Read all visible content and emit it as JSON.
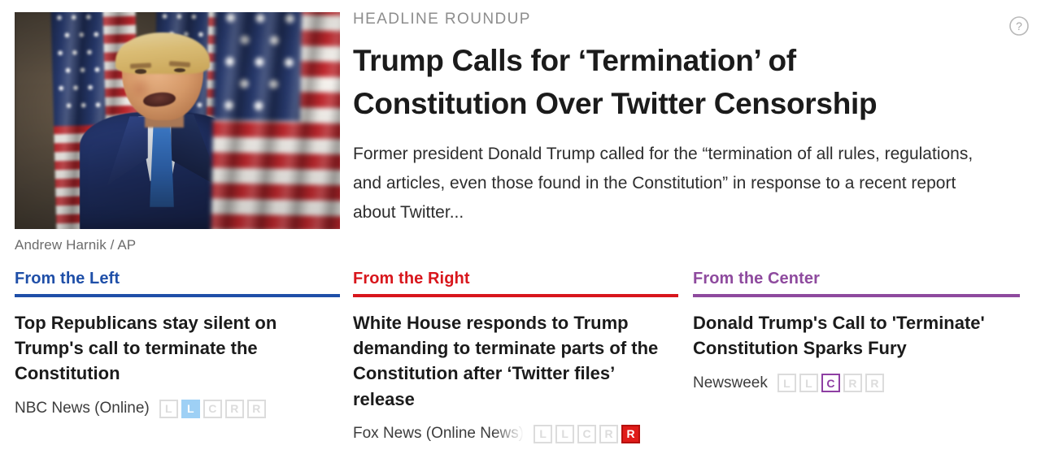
{
  "article": {
    "kicker": "HEADLINE ROUNDUP",
    "headline": "Trump Calls for ‘Termination’ of Constitution Over Twitter Censorship",
    "summary": "Former president Donald Trump called for the “termination of all rules, regulations, and articles, even those found in the Constitution” in response to a recent report about Twitter...",
    "photo_caption": "Andrew Harnik / AP",
    "help_icon": "question-circle-icon"
  },
  "colors": {
    "left": "#1f4fa8",
    "right": "#d8161c",
    "center": "#8e4a9e",
    "kicker_text": "#8d8d8d",
    "body_text": "#2e2e2e",
    "inactive_box": "#dcdcdc",
    "left_box_active": "#9ed0f5",
    "right_box_active": "#e01b18",
    "center_box_active": "#8e3fa3"
  },
  "columns": [
    {
      "id": "left",
      "heading": "From the Left",
      "story_title": "Top Republicans stay silent on Trump's call to terminate the Constitution",
      "source": "NBC News (Online)",
      "source_truncated": false,
      "bias_labels": [
        "L",
        "L",
        "C",
        "R",
        "R"
      ],
      "bias_active_index": 1,
      "bias_active_label": "L"
    },
    {
      "id": "right",
      "heading": "From the Right",
      "story_title": "White House responds to Trump demanding to terminate parts of the Constitution after ‘Twitter files’ release",
      "source": "Fox News (Online News)",
      "source_truncated": true,
      "bias_labels": [
        "L",
        "L",
        "C",
        "R",
        "R"
      ],
      "bias_active_index": 4,
      "bias_active_label": "R"
    },
    {
      "id": "center",
      "heading": "From the Center",
      "story_title": "Donald Trump's Call to 'Terminate' Constitution Sparks Fury",
      "source": "Newsweek",
      "source_truncated": false,
      "bias_labels": [
        "L",
        "L",
        "C",
        "R",
        "R"
      ],
      "bias_active_index": 2,
      "bias_active_label": "C"
    }
  ]
}
